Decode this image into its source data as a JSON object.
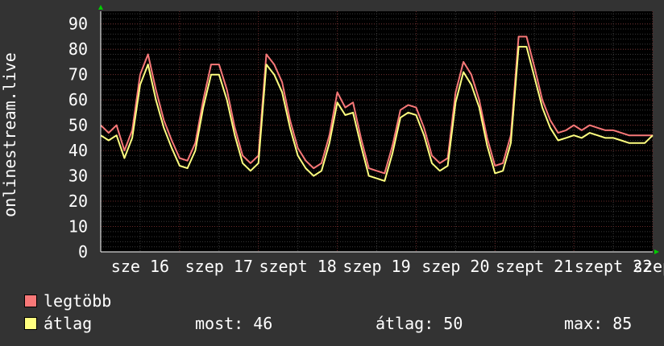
{
  "chart_data": {
    "type": "line",
    "ylabel": "onlinestream.live",
    "ylim": [
      0,
      95
    ],
    "yticks": [
      0,
      10,
      20,
      30,
      40,
      50,
      60,
      70,
      80,
      90
    ],
    "grid": true,
    "x_tick_labels": [
      {
        "t": 0.5,
        "label": "sze 16"
      },
      {
        "t": 1.5,
        "label": "szep 17"
      },
      {
        "t": 2.5,
        "label": "szept 18"
      },
      {
        "t": 3.5,
        "label": "szep 19"
      },
      {
        "t": 4.5,
        "label": "szep 20"
      },
      {
        "t": 5.5,
        "label": "szept 21"
      },
      {
        "t": 6.5,
        "label": "szept 22"
      },
      {
        "t": 7.0,
        "label": "szep"
      }
    ],
    "series": [
      {
        "name": "legtöbb",
        "color": "#f87878",
        "x": [
          0,
          0.1,
          0.2,
          0.3,
          0.4,
          0.5,
          0.6,
          0.7,
          0.8,
          0.9,
          1.0,
          1.1,
          1.2,
          1.3,
          1.4,
          1.5,
          1.6,
          1.7,
          1.8,
          1.9,
          2.0,
          2.1,
          2.2,
          2.3,
          2.4,
          2.5,
          2.6,
          2.7,
          2.8,
          2.9,
          3.0,
          3.1,
          3.2,
          3.3,
          3.4,
          3.5,
          3.6,
          3.7,
          3.8,
          3.9,
          4.0,
          4.1,
          4.2,
          4.3,
          4.4,
          4.5,
          4.6,
          4.7,
          4.8,
          4.9,
          5.0,
          5.1,
          5.2,
          5.3,
          5.4,
          5.5,
          5.6,
          5.7,
          5.8,
          5.9,
          6.0,
          6.1,
          6.2,
          6.3,
          6.4,
          6.5,
          6.6,
          6.7,
          6.8,
          6.9,
          7.0
        ],
        "values": [
          50,
          47,
          50,
          40,
          48,
          70,
          78,
          64,
          52,
          44,
          37,
          36,
          43,
          60,
          74,
          74,
          64,
          49,
          38,
          35,
          38,
          78,
          74,
          67,
          52,
          41,
          36,
          33,
          35,
          46,
          63,
          57,
          59,
          45,
          33,
          32,
          31,
          42,
          56,
          58,
          57,
          49,
          38,
          35,
          37,
          63,
          75,
          70,
          60,
          45,
          34,
          35,
          46,
          85,
          85,
          73,
          60,
          52,
          47,
          48,
          50,
          48,
          50,
          49,
          48,
          48,
          47,
          46,
          46,
          46,
          46
        ]
      },
      {
        "name": "átlag",
        "color": "#ffff80",
        "x": [
          0,
          0.1,
          0.2,
          0.3,
          0.4,
          0.5,
          0.6,
          0.7,
          0.8,
          0.9,
          1.0,
          1.1,
          1.2,
          1.3,
          1.4,
          1.5,
          1.6,
          1.7,
          1.8,
          1.9,
          2.0,
          2.1,
          2.2,
          2.3,
          2.4,
          2.5,
          2.6,
          2.7,
          2.8,
          2.9,
          3.0,
          3.1,
          3.2,
          3.3,
          3.4,
          3.5,
          3.6,
          3.7,
          3.8,
          3.9,
          4.0,
          4.1,
          4.2,
          4.3,
          4.4,
          4.5,
          4.6,
          4.7,
          4.8,
          4.9,
          5.0,
          5.1,
          5.2,
          5.3,
          5.4,
          5.5,
          5.6,
          5.7,
          5.8,
          5.9,
          6.0,
          6.1,
          6.2,
          6.3,
          6.4,
          6.5,
          6.6,
          6.7,
          6.8,
          6.9,
          7.0
        ],
        "values": [
          46,
          44,
          46,
          37,
          45,
          66,
          74,
          60,
          49,
          41,
          34,
          33,
          40,
          57,
          70,
          70,
          60,
          46,
          35,
          32,
          35,
          74,
          70,
          63,
          49,
          38,
          33,
          30,
          32,
          43,
          59,
          54,
          55,
          42,
          30,
          29,
          28,
          39,
          53,
          55,
          54,
          46,
          35,
          32,
          34,
          59,
          71,
          66,
          57,
          42,
          31,
          32,
          43,
          81,
          81,
          69,
          57,
          49,
          44,
          45,
          46,
          45,
          47,
          46,
          45,
          45,
          44,
          43,
          43,
          43,
          46
        ]
      }
    ],
    "legend": [
      {
        "label": "legtöbb",
        "color": "#f87878"
      },
      {
        "label": "átlag",
        "color": "#ffff80"
      }
    ],
    "stats": {
      "current": "most: 46",
      "average": "átlag: 50",
      "maximum": "max: 85"
    }
  }
}
